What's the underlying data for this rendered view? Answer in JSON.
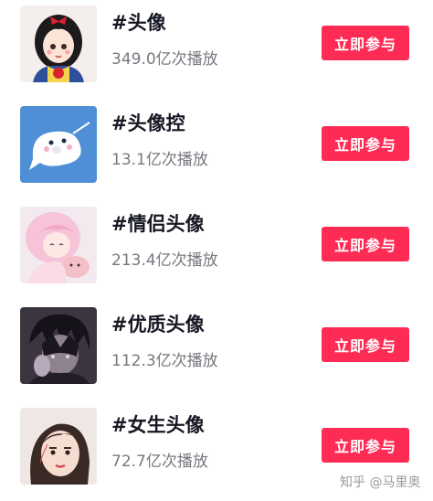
{
  "colors": {
    "accent": "#fe2c55",
    "title_text": "#161823",
    "secondary_text": "#77787f"
  },
  "topics": [
    {
      "title": "#头像",
      "plays": "349.0亿次播放",
      "button": "立即参与",
      "thumbnail": "snow-white-cartoon-avatar"
    },
    {
      "title": "#头像控",
      "plays": "13.1亿次播放",
      "button": "立即参与",
      "thumbnail": "white-seal-cartoon-avatar"
    },
    {
      "title": "#情侣头像",
      "plays": "213.4亿次播放",
      "button": "立即参与",
      "thumbnail": "pink-anime-girl-avatar"
    },
    {
      "title": "#优质头像",
      "plays": "112.3亿次播放",
      "button": "立即参与",
      "thumbnail": "dark-anime-boy-avatar"
    },
    {
      "title": "#女生头像",
      "plays": "72.7亿次播放",
      "button": "立即参与",
      "thumbnail": "sketch-girl-avatar"
    }
  ],
  "watermark": "知乎 @马里奥"
}
